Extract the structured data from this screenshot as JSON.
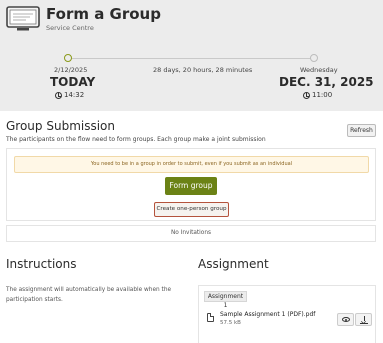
{
  "header": {
    "title": "Form a Group",
    "subtitle": "Service Centre",
    "logo_icon": "monitor-icon"
  },
  "timeline": {
    "start": {
      "date": "2/12/2025",
      "label": "TODAY",
      "time": "14:32"
    },
    "remaining": "28 days, 20 hours, 28 minutes",
    "end": {
      "weekday": "Wednesday",
      "label": "DEC. 31, 2025",
      "time": "11:00"
    },
    "accent_color": "#8a9a1a"
  },
  "group_submission": {
    "title": "Group Submission",
    "description": "The participants on the flow need to form groups. Each group make a joint submission",
    "refresh_label": "Refresh",
    "warning": "You need to be in a group in order to submit, even if you submit as an individual",
    "form_group_label": "Form group",
    "one_person_label": "Create one-person group",
    "no_invitations": "No Invitations"
  },
  "instructions": {
    "title": "Instructions",
    "text": "The assignment will automatically be available when the participation starts."
  },
  "assignment": {
    "title": "Assignment",
    "tag": "Assignment 1",
    "file_name": "Sample Assignment 1 (PDF).pdf",
    "file_size": "57.5 kB"
  },
  "colors": {
    "primary_button": "#6b8215",
    "highlight_border": "#b4533c",
    "header_bg": "#ececec"
  }
}
